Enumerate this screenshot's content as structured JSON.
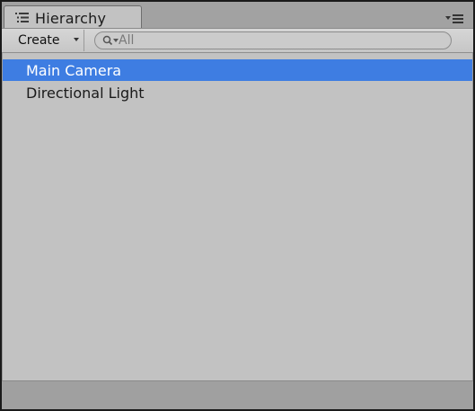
{
  "window": {
    "tab_title": "Hierarchy",
    "tab_icon": "hierarchy-list-icon",
    "menu_icon": "panel-menu-icon"
  },
  "toolbar": {
    "create_label": "Create",
    "create_dropdown_icon": "chevron-down-icon",
    "search": {
      "icon": "search-filter-icon",
      "placeholder": "All",
      "value": ""
    }
  },
  "hierarchy": {
    "items": [
      {
        "label": "Main Camera",
        "selected": true
      },
      {
        "label": "Directional Light",
        "selected": false
      }
    ]
  },
  "colors": {
    "selection": "#3e7de2",
    "panel_background": "#c2c2c2",
    "chrome": "#a3a3a3"
  }
}
